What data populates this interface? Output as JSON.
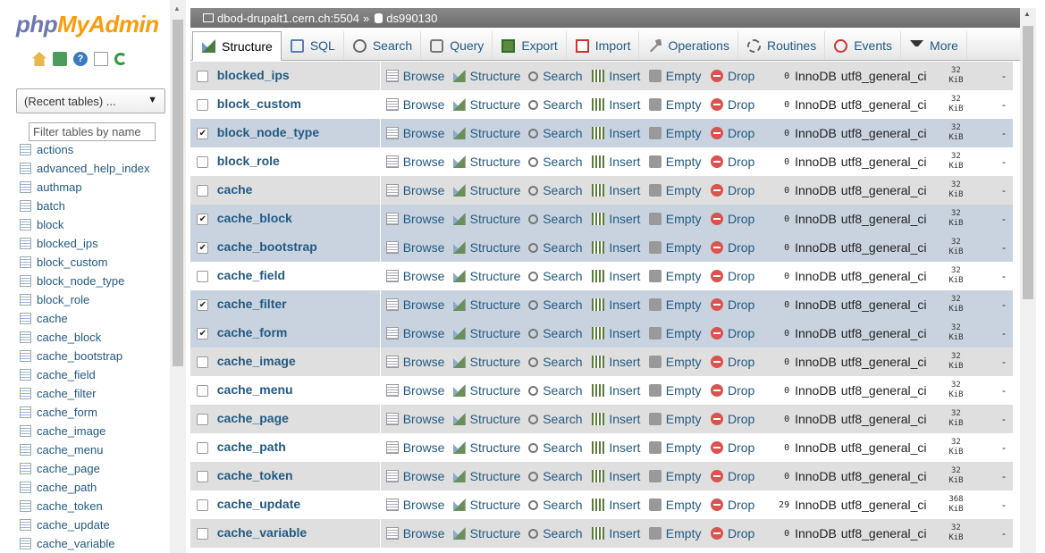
{
  "logo": {
    "part1": "php",
    "part2": "MyAdmin"
  },
  "nav": {
    "icons": [
      "home-icon",
      "exit-icon",
      "help-icon",
      "docs-icon",
      "reload-icon"
    ],
    "recent_tables": "(Recent tables) ...",
    "filter_placeholder": "Filter tables by name",
    "tables": [
      "actions",
      "advanced_help_index",
      "authmap",
      "batch",
      "block",
      "blocked_ips",
      "block_custom",
      "block_node_type",
      "block_role",
      "cache",
      "cache_block",
      "cache_bootstrap",
      "cache_field",
      "cache_filter",
      "cache_form",
      "cache_image",
      "cache_menu",
      "cache_page",
      "cache_path",
      "cache_token",
      "cache_update",
      "cache_variable"
    ]
  },
  "breadcrumb": {
    "server": "dbod-drupalt1.cern.ch:5504",
    "separator": "»",
    "database": "ds990130"
  },
  "tabs": [
    "Structure",
    "SQL",
    "Search",
    "Query",
    "Export",
    "Import",
    "Operations",
    "Routines",
    "Events",
    "More"
  ],
  "actions": {
    "browse": "Browse",
    "structure": "Structure",
    "search": "Search",
    "insert": "Insert",
    "empty": "Empty",
    "drop": "Drop"
  },
  "rows": [
    {
      "name": "blocked_ips",
      "checked": false,
      "rows": "0",
      "engine": "InnoDB",
      "collation": "utf8_general_ci",
      "size": "32",
      "unit": "KiB",
      "overhead": "-"
    },
    {
      "name": "block_custom",
      "checked": false,
      "rows": "0",
      "engine": "InnoDB",
      "collation": "utf8_general_ci",
      "size": "32",
      "unit": "KiB",
      "overhead": "-"
    },
    {
      "name": "block_node_type",
      "checked": true,
      "rows": "0",
      "engine": "InnoDB",
      "collation": "utf8_general_ci",
      "size": "32",
      "unit": "KiB",
      "overhead": "-"
    },
    {
      "name": "block_role",
      "checked": false,
      "rows": "0",
      "engine": "InnoDB",
      "collation": "utf8_general_ci",
      "size": "32",
      "unit": "KiB",
      "overhead": "-"
    },
    {
      "name": "cache",
      "checked": false,
      "rows": "0",
      "engine": "InnoDB",
      "collation": "utf8_general_ci",
      "size": "32",
      "unit": "KiB",
      "overhead": "-"
    },
    {
      "name": "cache_block",
      "checked": true,
      "rows": "0",
      "engine": "InnoDB",
      "collation": "utf8_general_ci",
      "size": "32",
      "unit": "KiB",
      "overhead": "-"
    },
    {
      "name": "cache_bootstrap",
      "checked": true,
      "rows": "0",
      "engine": "InnoDB",
      "collation": "utf8_general_ci",
      "size": "32",
      "unit": "KiB",
      "overhead": "-"
    },
    {
      "name": "cache_field",
      "checked": false,
      "rows": "0",
      "engine": "InnoDB",
      "collation": "utf8_general_ci",
      "size": "32",
      "unit": "KiB",
      "overhead": "-"
    },
    {
      "name": "cache_filter",
      "checked": true,
      "rows": "0",
      "engine": "InnoDB",
      "collation": "utf8_general_ci",
      "size": "32",
      "unit": "KiB",
      "overhead": "-"
    },
    {
      "name": "cache_form",
      "checked": true,
      "rows": "0",
      "engine": "InnoDB",
      "collation": "utf8_general_ci",
      "size": "32",
      "unit": "KiB",
      "overhead": "-"
    },
    {
      "name": "cache_image",
      "checked": false,
      "rows": "0",
      "engine": "InnoDB",
      "collation": "utf8_general_ci",
      "size": "32",
      "unit": "KiB",
      "overhead": "-"
    },
    {
      "name": "cache_menu",
      "checked": false,
      "rows": "0",
      "engine": "InnoDB",
      "collation": "utf8_general_ci",
      "size": "32",
      "unit": "KiB",
      "overhead": "-"
    },
    {
      "name": "cache_page",
      "checked": false,
      "rows": "0",
      "engine": "InnoDB",
      "collation": "utf8_general_ci",
      "size": "32",
      "unit": "KiB",
      "overhead": "-"
    },
    {
      "name": "cache_path",
      "checked": false,
      "rows": "0",
      "engine": "InnoDB",
      "collation": "utf8_general_ci",
      "size": "32",
      "unit": "KiB",
      "overhead": "-"
    },
    {
      "name": "cache_token",
      "checked": false,
      "rows": "0",
      "engine": "InnoDB",
      "collation": "utf8_general_ci",
      "size": "32",
      "unit": "KiB",
      "overhead": "-"
    },
    {
      "name": "cache_update",
      "checked": false,
      "rows": "29",
      "engine": "InnoDB",
      "collation": "utf8_general_ci",
      "size": "368",
      "unit": "KiB",
      "overhead": "-"
    },
    {
      "name": "cache_variable",
      "checked": false,
      "rows": "0",
      "engine": "InnoDB",
      "collation": "utf8_general_ci",
      "size": "32",
      "unit": "KiB",
      "overhead": "-"
    }
  ],
  "colors": {
    "link": "#235a81",
    "logo_blue": "#6c78af",
    "logo_orange": "#f89c0e",
    "row_marked": "#c9d3e0",
    "row_even": "#dfdfdf"
  }
}
